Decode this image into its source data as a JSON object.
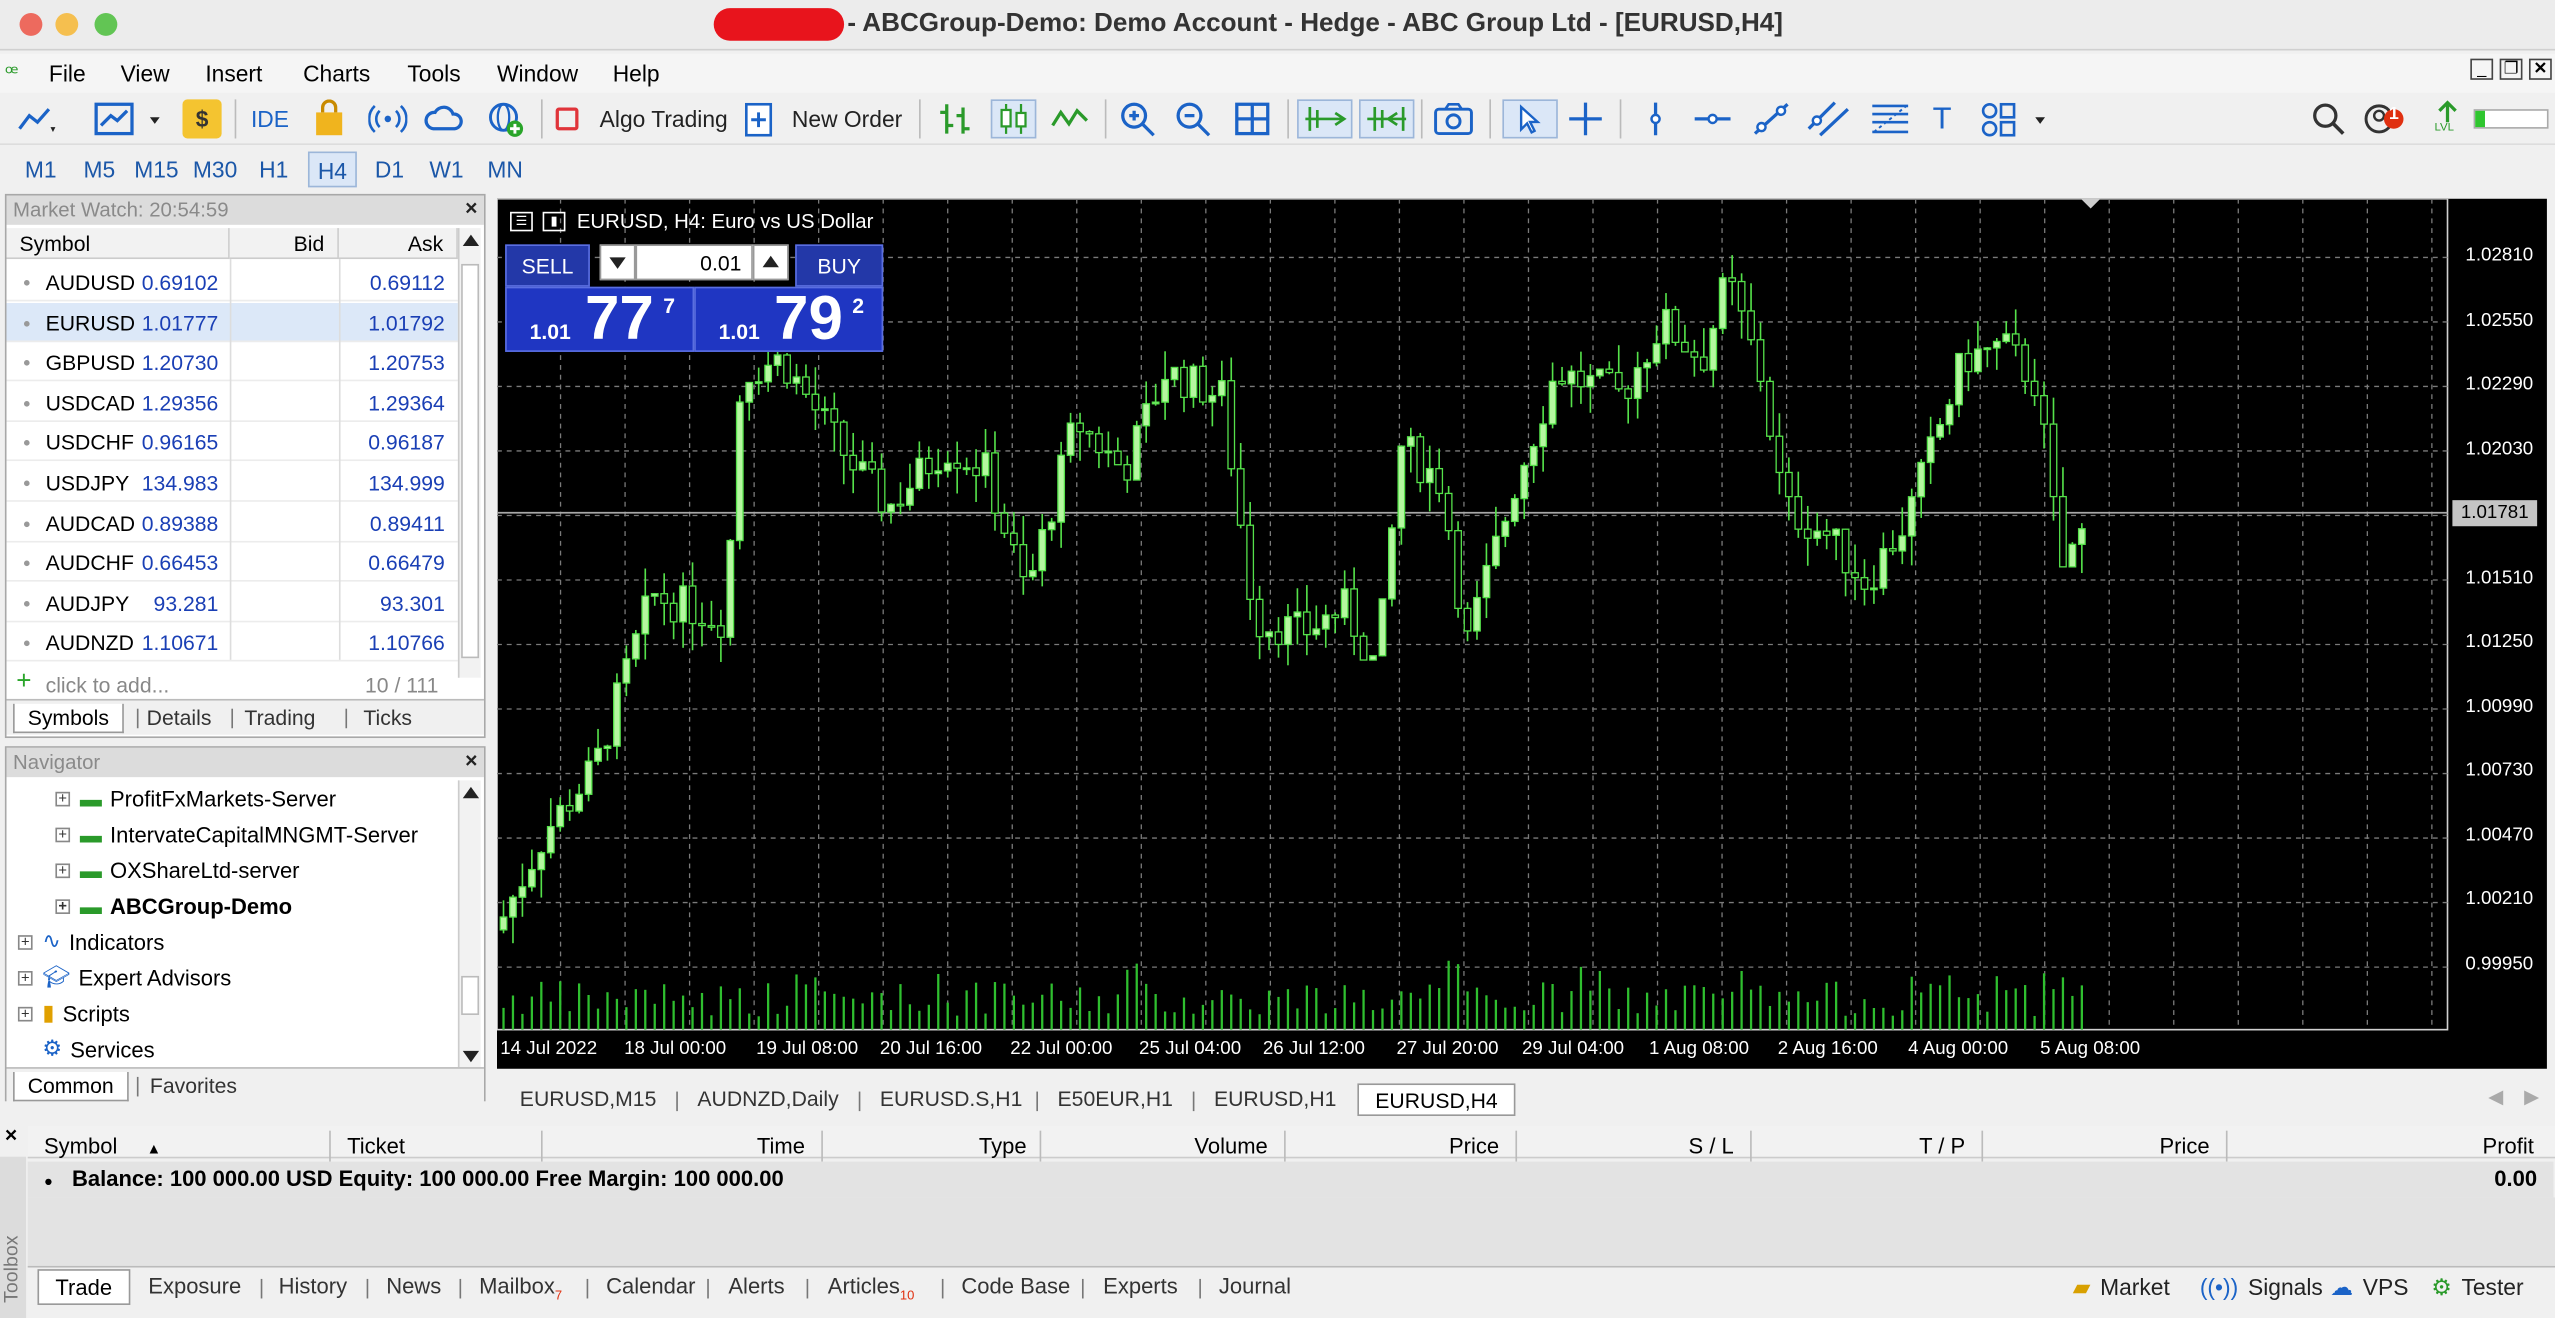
{
  "window": {
    "title": "- ABCGroup-Demo: Demo Account - Hedge - ABC Group Ltd - [EURUSD,H4]",
    "controls": [
      "close",
      "minimize",
      "zoom"
    ]
  },
  "menu": [
    "File",
    "View",
    "Insert",
    "Charts",
    "Tools",
    "Window",
    "Help"
  ],
  "toolbar": {
    "ide_label": "IDE",
    "algo_label": "Algo Trading",
    "new_order_label": "New Order",
    "notif_count": "1",
    "lvl_label": "LVL"
  },
  "periods": [
    "M1",
    "M5",
    "M15",
    "M30",
    "H1",
    "H4",
    "D1",
    "W1",
    "MN"
  ],
  "active_period": "H4",
  "market_watch": {
    "title": "Market Watch: 20:54:59",
    "columns": [
      "Symbol",
      "Bid",
      "Ask"
    ],
    "rows": [
      {
        "symbol": "AUDUSD",
        "bid": "0.69102",
        "ask": "0.69112"
      },
      {
        "symbol": "EURUSD",
        "bid": "1.01777",
        "ask": "1.01792"
      },
      {
        "symbol": "GBPUSD",
        "bid": "1.20730",
        "ask": "1.20753"
      },
      {
        "symbol": "USDCAD",
        "bid": "1.29356",
        "ask": "1.29364"
      },
      {
        "symbol": "USDCHF",
        "bid": "0.96165",
        "ask": "0.96187"
      },
      {
        "symbol": "USDJPY",
        "bid": "134.983",
        "ask": "134.999"
      },
      {
        "symbol": "AUDCAD",
        "bid": "0.89388",
        "ask": "0.89411"
      },
      {
        "symbol": "AUDCHF",
        "bid": "0.66453",
        "ask": "0.66479"
      },
      {
        "symbol": "AUDJPY",
        "bid": "93.281",
        "ask": "93.301"
      },
      {
        "symbol": "AUDNZD",
        "bid": "1.10671",
        "ask": "1.10766"
      }
    ],
    "add_placeholder": "click to add...",
    "count": "10 / 111",
    "tabs": [
      "Symbols",
      "Details",
      "Trading",
      "Ticks"
    ]
  },
  "navigator": {
    "title": "Navigator",
    "servers": [
      "ProfitFxMarkets-Server",
      "IntervateCapitalMNGMT-Server",
      "OXShareLtd-server",
      "ABCGroup-Demo"
    ],
    "items": [
      "Indicators",
      "Expert Advisors",
      "Scripts",
      "Services"
    ],
    "tabs": [
      "Common",
      "Favorites"
    ]
  },
  "chart": {
    "header": "EURUSD, H4:  Euro vs US Dollar",
    "sell_label": "SELL",
    "buy_label": "BUY",
    "volume": "0.01",
    "sell_prefix": "1.01",
    "sell_big": "77",
    "sell_sup": "7",
    "buy_prefix": "1.01",
    "buy_big": "79",
    "buy_sup": "2",
    "current_price": "1.01781",
    "price_labels": [
      "1.02810",
      "1.02550",
      "1.02290",
      "1.02030",
      "1.01510",
      "1.01250",
      "1.00990",
      "1.00730",
      "1.00470",
      "1.00210",
      "0.99950"
    ],
    "time_labels": [
      "14 Jul 2022",
      "18 Jul 00:00",
      "19 Jul 08:00",
      "20 Jul 16:00",
      "22 Jul 00:00",
      "25 Jul 04:00",
      "26 Jul 12:00",
      "27 Jul 20:00",
      "29 Jul 04:00",
      "1 Aug 08:00",
      "2 Aug 16:00",
      "4 Aug 00:00",
      "5 Aug 08:00"
    ]
  },
  "chart_tabs": [
    "EURUSD,M15",
    "AUDNZD,Daily",
    "EURUSD.S,H1",
    "E50EUR,H1",
    "EURUSD,H1",
    "EURUSD,H4"
  ],
  "toolbox": {
    "side_label": "Toolbox",
    "columns": [
      "Symbol",
      "Ticket",
      "Time",
      "Type",
      "Volume",
      "Price",
      "S / L",
      "T / P",
      "Price",
      "Profit"
    ],
    "balance_line": "Balance: 100 000.00 USD  Equity: 100 000.00  Free Margin: 100 000.00",
    "profit_total": "0.00",
    "tabs": [
      "Trade",
      "Exposure",
      "History",
      "News",
      "Mailbox",
      "Calendar",
      "Alerts",
      "Articles",
      "Code Base",
      "Experts",
      "Journal"
    ],
    "mailbox_badge": "7",
    "articles_badge": "10",
    "right_tools": [
      "Market",
      "Signals",
      "VPS",
      "Tester"
    ]
  },
  "colors": {
    "bull_candle": "#b5f7a0",
    "bear_candle": "#000000",
    "candle_wick": "#55e14a",
    "grid": "#8a8a8a",
    "trade_blue": "#1f36c2"
  }
}
